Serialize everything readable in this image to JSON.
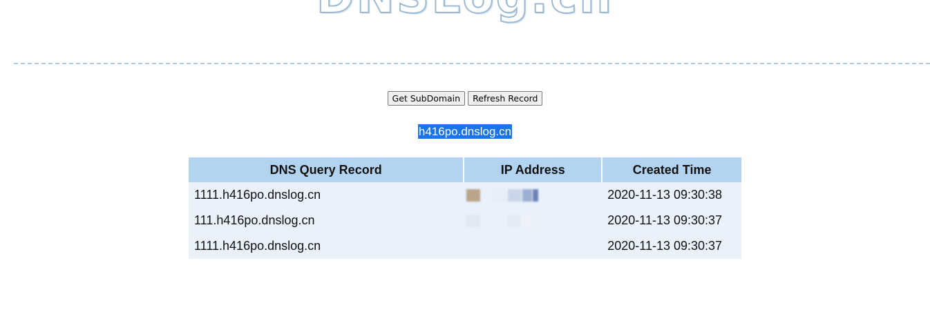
{
  "logo": {
    "text": "DNSLog.cn"
  },
  "buttons": {
    "get_subdomain": "Get SubDomain",
    "refresh_record": "Refresh Record"
  },
  "subdomain": "h416po.dnslog.cn",
  "table": {
    "headers": [
      "DNS Query Record",
      "IP Address",
      "Created Time"
    ],
    "rows": [
      {
        "query": "1111.h416po.dnslog.cn",
        "ip": "(redacted)",
        "time": "2020-11-13 09:30:38"
      },
      {
        "query": "111.h416po.dnslog.cn",
        "ip": "(redacted)",
        "time": "2020-11-13 09:30:37"
      },
      {
        "query": "1111.h416po.dnslog.cn",
        "ip": "(redacted)",
        "time": "2020-11-13 09:30:37"
      }
    ]
  },
  "colors": {
    "header_bg": "#b2d4f0",
    "row_bg": "#e9f1fb",
    "divider": "#a9c9e6",
    "selection": "#1a73e8"
  }
}
